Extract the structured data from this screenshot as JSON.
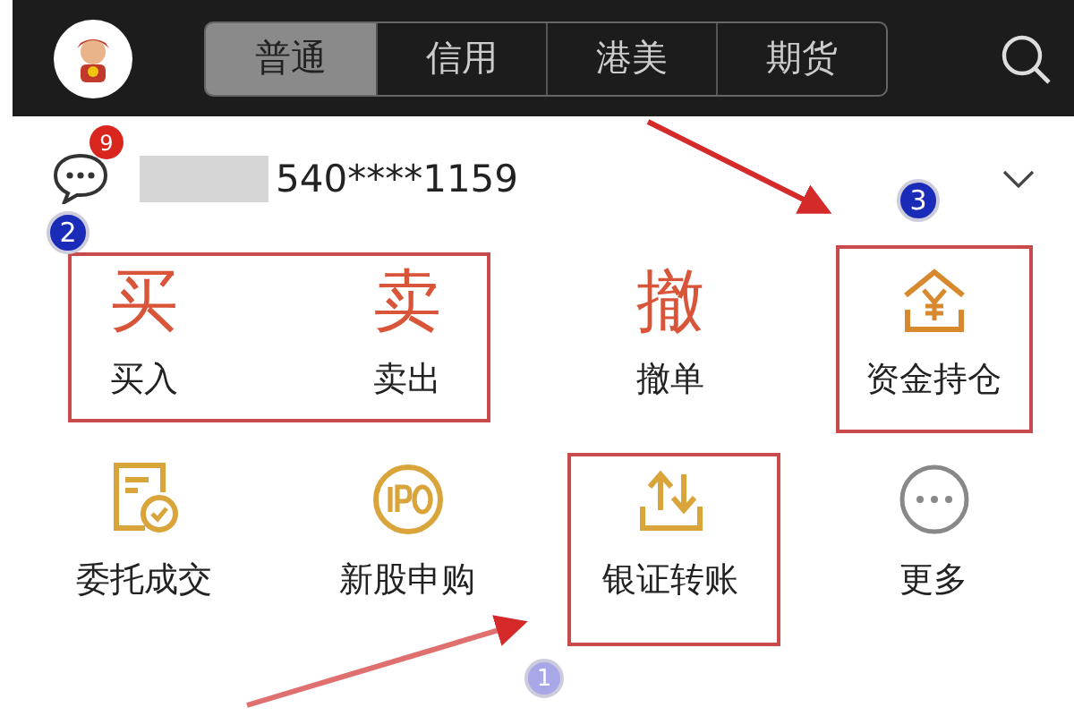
{
  "header": {
    "tabs": [
      {
        "label": "普通",
        "selected": true
      },
      {
        "label": "信用",
        "selected": false
      },
      {
        "label": "港美",
        "selected": false
      },
      {
        "label": "期货",
        "selected": false
      }
    ]
  },
  "account": {
    "message_count": "9",
    "number": "540****1159"
  },
  "actions": [
    {
      "kind": "glyph",
      "glyph": "买",
      "label": "买入"
    },
    {
      "kind": "glyph",
      "glyph": "卖",
      "label": "卖出"
    },
    {
      "kind": "glyph",
      "glyph": "撤",
      "label": "撤单"
    },
    {
      "kind": "fund",
      "label": "资金持仓"
    },
    {
      "kind": "order",
      "label": "委托成交"
    },
    {
      "kind": "ipo",
      "label": "新股申购"
    },
    {
      "kind": "transfer",
      "label": "银证转账"
    },
    {
      "kind": "more",
      "label": "更多"
    }
  ],
  "annotations": {
    "markers": [
      "1",
      "2",
      "3"
    ]
  }
}
